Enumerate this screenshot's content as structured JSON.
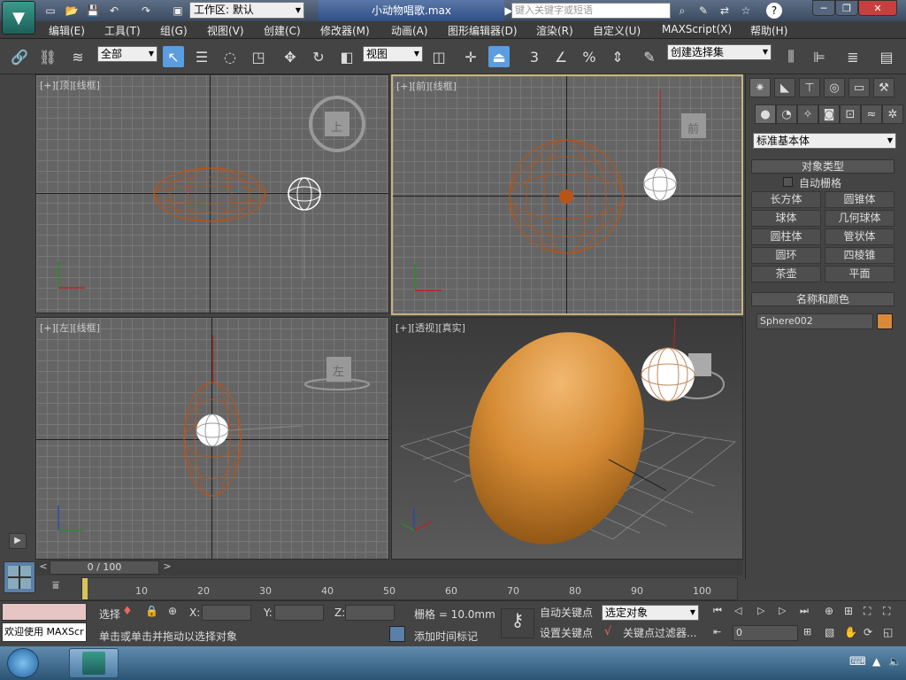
{
  "titlebar": {
    "workspace_label": "工作区: 默认",
    "document_title": "小动物唱歌.max",
    "search_placeholder": "键入关键字或短语"
  },
  "menu": [
    "编辑(E)",
    "工具(T)",
    "组(G)",
    "视图(V)",
    "创建(C)",
    "修改器(M)",
    "动画(A)",
    "图形编辑器(D)",
    "渲染(R)",
    "自定义(U)",
    "MAXScript(X)",
    "帮助(H)"
  ],
  "toolbar": {
    "filter_value": "全部",
    "refcoord_value": "视图",
    "selection_set_value": "创建选择集",
    "snap_label": "3"
  },
  "viewports": {
    "top": "[+][顶][线框]",
    "front": "[+][前][线框]",
    "left": "[+][左][线框]",
    "perspective": "[+][透视][真实]",
    "cube_top": "上",
    "cube_front": "前",
    "cube_left": "左"
  },
  "command_panel": {
    "category_value": "标准基本体",
    "object_type_title": "对象类型",
    "autogrid_label": "自动栅格",
    "buttons": [
      "长方体",
      "圆锥体",
      "球体",
      "几何球体",
      "圆柱体",
      "管状体",
      "圆环",
      "四棱锥",
      "茶壶",
      "平面"
    ],
    "name_color_title": "名称和颜色",
    "object_name": "Sphere002",
    "object_color": "#d9893a"
  },
  "timeline": {
    "frame_label": "0 / 100",
    "ticks": [
      "10",
      "20",
      "30",
      "40",
      "50",
      "60",
      "70",
      "80",
      "90",
      "100"
    ]
  },
  "status": {
    "select_label": "选择",
    "x_label": "X:",
    "y_label": "Y:",
    "z_label": "Z:",
    "grid_label": "栅格 = 10.0mm",
    "autokey_label": "自动关键点",
    "setkey_label": "设置关键点",
    "selected_value": "选定对象",
    "keyfilter_label": "关键点过滤器...",
    "prompt": "单击或单击并拖动以选择对象",
    "add_time_tag": "添加时间标记",
    "welcome": "欢迎使用 MAXScr",
    "frame_value": "0"
  }
}
